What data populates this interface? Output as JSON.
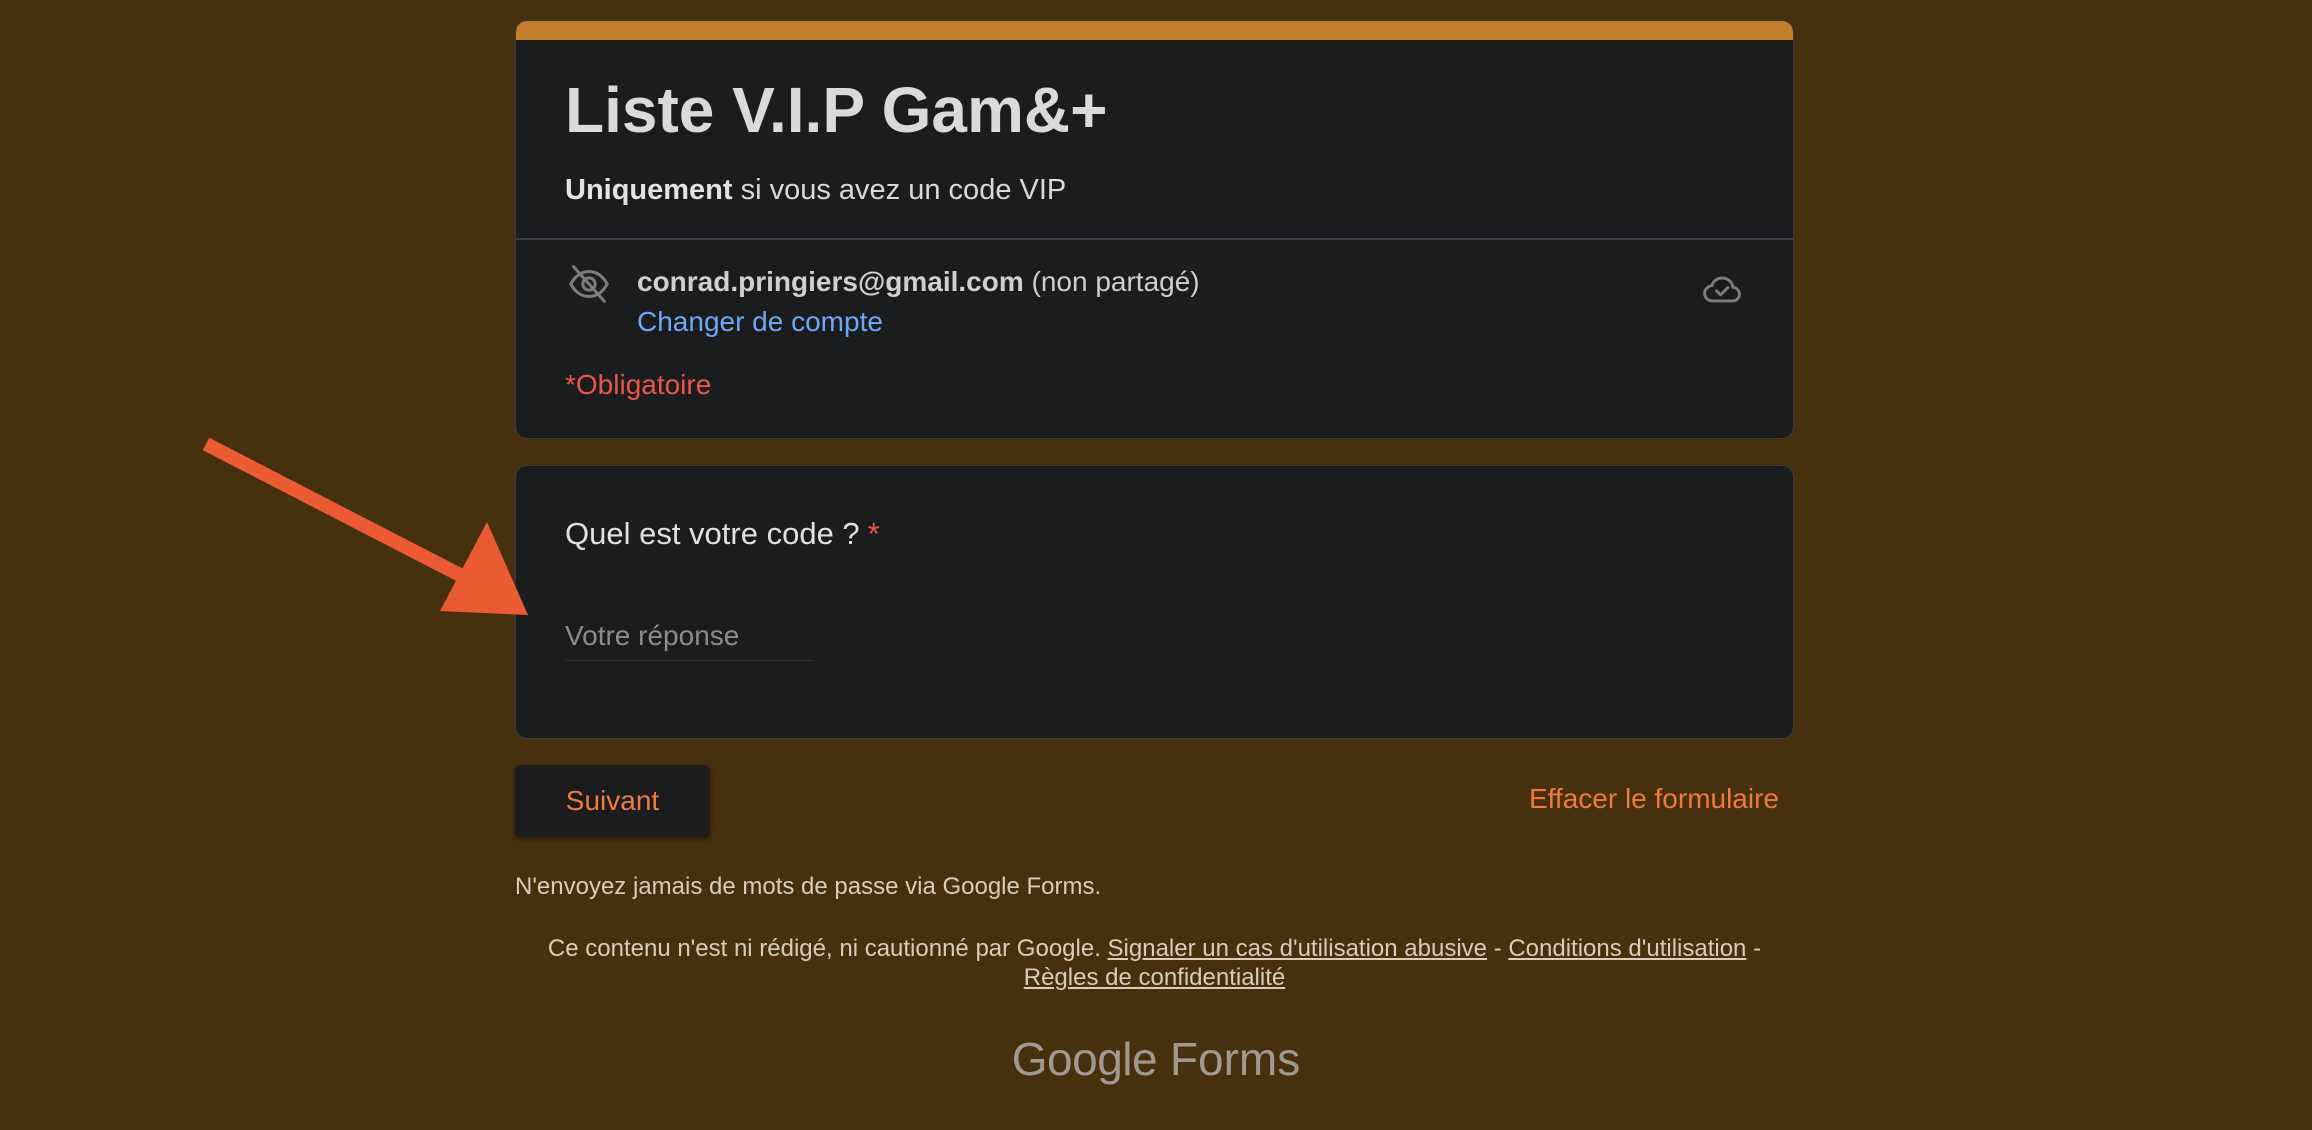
{
  "form": {
    "title": "Liste V.I.P Gam&+",
    "description_bold": "Uniquement",
    "description_rest": " si vous avez un code VIP",
    "account_email": "conrad.pringiers@gmail.com",
    "account_note": " (non partagé)",
    "switch_account": "Changer de compte",
    "required_note": "*Obligatoire"
  },
  "question": {
    "title": "Quel est votre code ?",
    "required_marker": "*",
    "answer_placeholder": "Votre réponse",
    "answer_value": ""
  },
  "actions": {
    "next_label": "Suivant",
    "clear_label": "Effacer le formulaire"
  },
  "footer": {
    "password_warning": "N'envoyez jamais de mots de passe via Google Forms.",
    "disclaimer": "Ce contenu n'est ni rédigé, ni cautionné par Google. ",
    "abuse_link": "Signaler un cas d'utilisation abusive",
    "sep1": " - ",
    "terms_link": "Conditions d'utilisation",
    "sep2": " -",
    "privacy_link": "Règles de confidentialité",
    "brand_google": "Google",
    "brand_forms": " Forms"
  },
  "colors": {
    "background": "#46300d",
    "card": "#1b1c1e",
    "accent_bar": "#c27e2a",
    "link_blue": "#6ea8f5",
    "required_red": "#e8574a",
    "action_orange": "#f07a3e",
    "annotation_arrow": "#ea5a33"
  },
  "icons": {
    "visibility": "eye-off-icon",
    "save_status": "cloud-check-icon",
    "annotation": "arrow-icon"
  }
}
